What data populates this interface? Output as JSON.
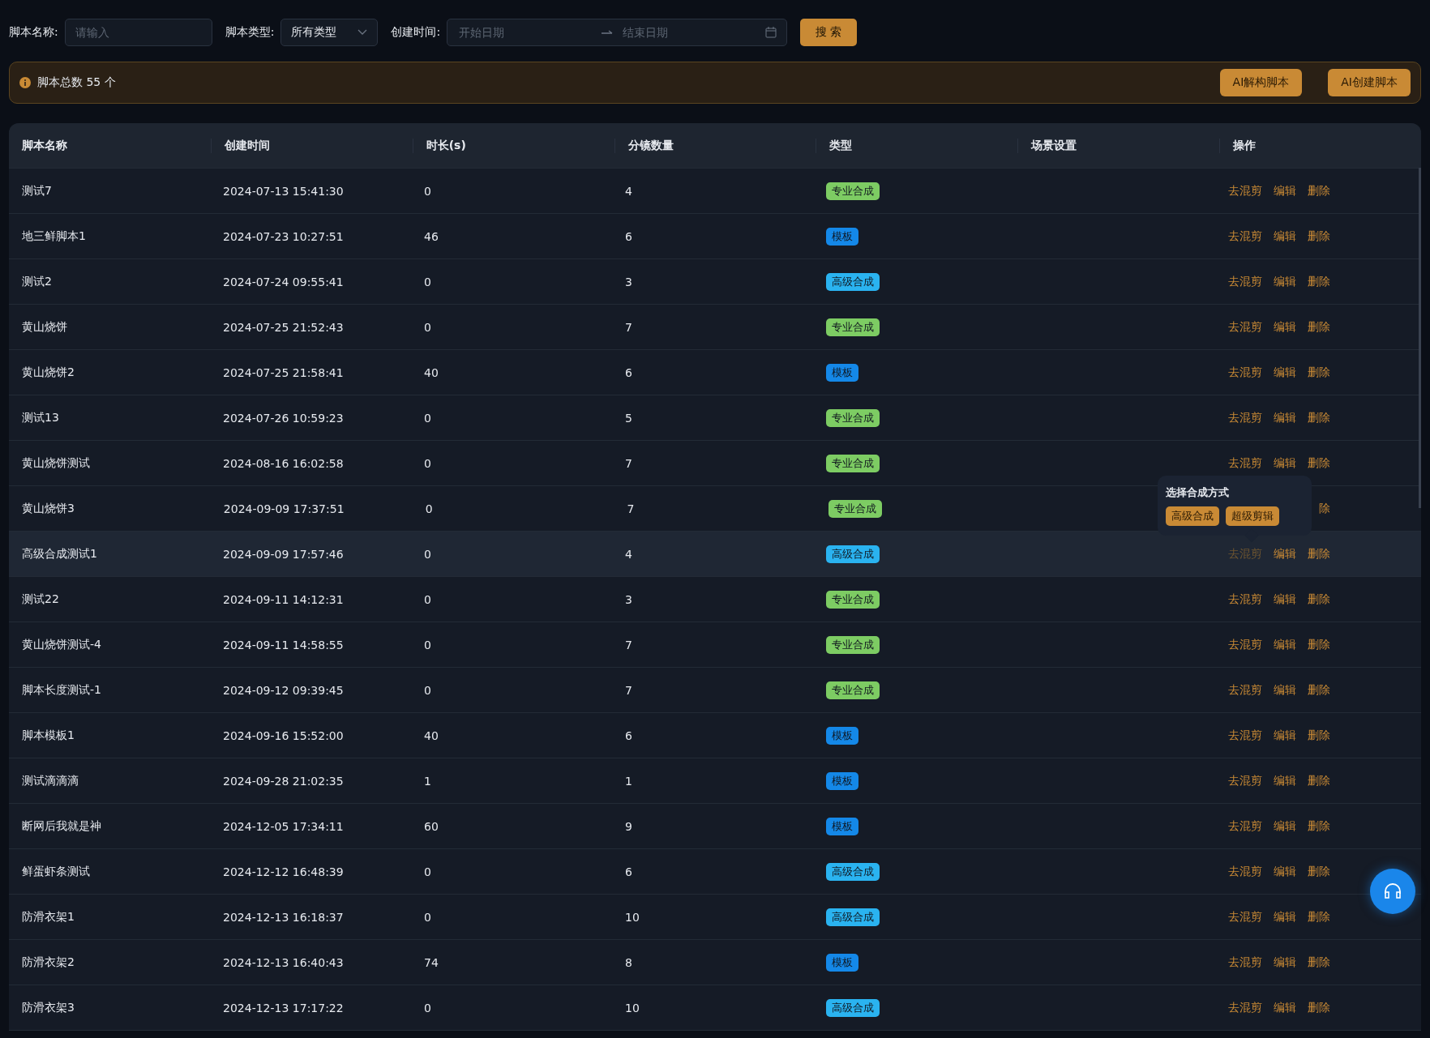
{
  "filters": {
    "name_label": "脚本名称:",
    "name_placeholder": "请输入",
    "type_label": "脚本类型:",
    "type_value": "所有类型",
    "date_label": "创建时间:",
    "start_placeholder": "开始日期",
    "end_placeholder": "结束日期",
    "search_button": "搜 索"
  },
  "summary": {
    "text": "脚本总数 55 个",
    "buttons": [
      "AI解构脚本",
      "AI创建脚本"
    ]
  },
  "table": {
    "columns": [
      "脚本名称",
      "创建时间",
      "时长(s)",
      "分镜数量",
      "类型",
      "场景设置",
      "操作"
    ],
    "rows": [
      {
        "name": "测试7",
        "created": "2024-07-13 15:41:30",
        "duration": "0",
        "shots": "4",
        "tag": {
          "label": "专业合成",
          "color": "#7dcc63"
        },
        "actions": [
          "去混剪",
          "编辑",
          "删除"
        ],
        "hovered": false
      },
      {
        "name": "地三鲜脚本1",
        "created": "2024-07-23 10:27:51",
        "duration": "46",
        "shots": "6",
        "tag": {
          "label": "模板",
          "color": "#1488e8"
        },
        "actions": [
          "去混剪",
          "编辑",
          "删除"
        ],
        "hovered": false
      },
      {
        "name": "测试2",
        "created": "2024-07-24 09:55:41",
        "duration": "0",
        "shots": "3",
        "tag": {
          "label": "高级合成",
          "color": "#2ab3f0"
        },
        "actions": [
          "去混剪",
          "编辑",
          "删除"
        ],
        "hovered": false
      },
      {
        "name": "黄山烧饼",
        "created": "2024-07-25 21:52:43",
        "duration": "0",
        "shots": "7",
        "tag": {
          "label": "专业合成",
          "color": "#7dcc63"
        },
        "actions": [
          "去混剪",
          "编辑",
          "删除"
        ],
        "hovered": false
      },
      {
        "name": "黄山烧饼2",
        "created": "2024-07-25 21:58:41",
        "duration": "40",
        "shots": "6",
        "tag": {
          "label": "模板",
          "color": "#1488e8"
        },
        "actions": [
          "去混剪",
          "编辑",
          "删除"
        ],
        "hovered": false
      },
      {
        "name": "测试13",
        "created": "2024-07-26 10:59:23",
        "duration": "0",
        "shots": "5",
        "tag": {
          "label": "专业合成",
          "color": "#7dcc63"
        },
        "actions": [
          "去混剪",
          "编辑",
          "删除"
        ],
        "hovered": false
      },
      {
        "name": "黄山烧饼测试",
        "created": "2024-08-16 16:02:58",
        "duration": "0",
        "shots": "7",
        "tag": {
          "label": "专业合成",
          "color": "#7dcc63"
        },
        "actions": [
          "去混剪",
          "编辑",
          "删除"
        ],
        "hovered": false
      },
      {
        "name": "黄山烧饼3",
        "created": "2024-09-09 17:37:51",
        "duration": "0",
        "shots": "7",
        "tag": {
          "label": "专业合成",
          "color": "#7dcc63"
        },
        "actions": [
          "除"
        ],
        "hovered": false,
        "popover": {
          "title": "选择合成方式",
          "buttons": [
            "高级合成",
            "超级剪辑"
          ]
        }
      },
      {
        "name": "高级合成测试1",
        "created": "2024-09-09 17:57:46",
        "duration": "0",
        "shots": "4",
        "tag": {
          "label": "高级合成",
          "color": "#2ab3f0"
        },
        "actions": [
          "去混剪",
          "编辑",
          "删除"
        ],
        "hovered": true
      },
      {
        "name": "测试22",
        "created": "2024-09-11 14:12:31",
        "duration": "0",
        "shots": "3",
        "tag": {
          "label": "专业合成",
          "color": "#7dcc63"
        },
        "actions": [
          "去混剪",
          "编辑",
          "删除"
        ],
        "hovered": false
      },
      {
        "name": "黄山烧饼测试-4",
        "created": "2024-09-11 14:58:55",
        "duration": "0",
        "shots": "7",
        "tag": {
          "label": "专业合成",
          "color": "#7dcc63"
        },
        "actions": [
          "去混剪",
          "编辑",
          "删除"
        ],
        "hovered": false
      },
      {
        "name": "脚本长度测试-1",
        "created": "2024-09-12 09:39:45",
        "duration": "0",
        "shots": "7",
        "tag": {
          "label": "专业合成",
          "color": "#7dcc63"
        },
        "actions": [
          "去混剪",
          "编辑",
          "删除"
        ],
        "hovered": false
      },
      {
        "name": "脚本模板1",
        "created": "2024-09-16 15:52:00",
        "duration": "40",
        "shots": "6",
        "tag": {
          "label": "模板",
          "color": "#1488e8"
        },
        "actions": [
          "去混剪",
          "编辑",
          "删除"
        ],
        "hovered": false
      },
      {
        "name": "测试滴滴滴",
        "created": "2024-09-28 21:02:35",
        "duration": "1",
        "shots": "1",
        "tag": {
          "label": "模板",
          "color": "#1488e8"
        },
        "actions": [
          "去混剪",
          "编辑",
          "删除"
        ],
        "hovered": false
      },
      {
        "name": "断网后我就是神",
        "created": "2024-12-05 17:34:11",
        "duration": "60",
        "shots": "9",
        "tag": {
          "label": "模板",
          "color": "#1488e8"
        },
        "actions": [
          "去混剪",
          "编辑",
          "删除"
        ],
        "hovered": false
      },
      {
        "name": "鲜蛋虾条测试",
        "created": "2024-12-12 16:48:39",
        "duration": "0",
        "shots": "6",
        "tag": {
          "label": "高级合成",
          "color": "#2ab3f0"
        },
        "actions": [
          "去混剪",
          "编辑",
          "删除"
        ],
        "hovered": false
      },
      {
        "name": "防滑衣架1",
        "created": "2024-12-13 16:18:37",
        "duration": "0",
        "shots": "10",
        "tag": {
          "label": "高级合成",
          "color": "#2ab3f0"
        },
        "actions": [
          "去混剪",
          "编辑",
          "删除"
        ],
        "hovered": false
      },
      {
        "name": "防滑衣架2",
        "created": "2024-12-13 16:40:43",
        "duration": "74",
        "shots": "8",
        "tag": {
          "label": "模板",
          "color": "#1488e8"
        },
        "actions": [
          "去混剪",
          "编辑",
          "删除"
        ],
        "hovered": false
      },
      {
        "name": "防滑衣架3",
        "created": "2024-12-13 17:17:22",
        "duration": "0",
        "shots": "10",
        "tag": {
          "label": "高级合成",
          "color": "#2ab3f0"
        },
        "actions": [
          "去混剪",
          "编辑",
          "删除"
        ],
        "hovered": false
      }
    ]
  }
}
